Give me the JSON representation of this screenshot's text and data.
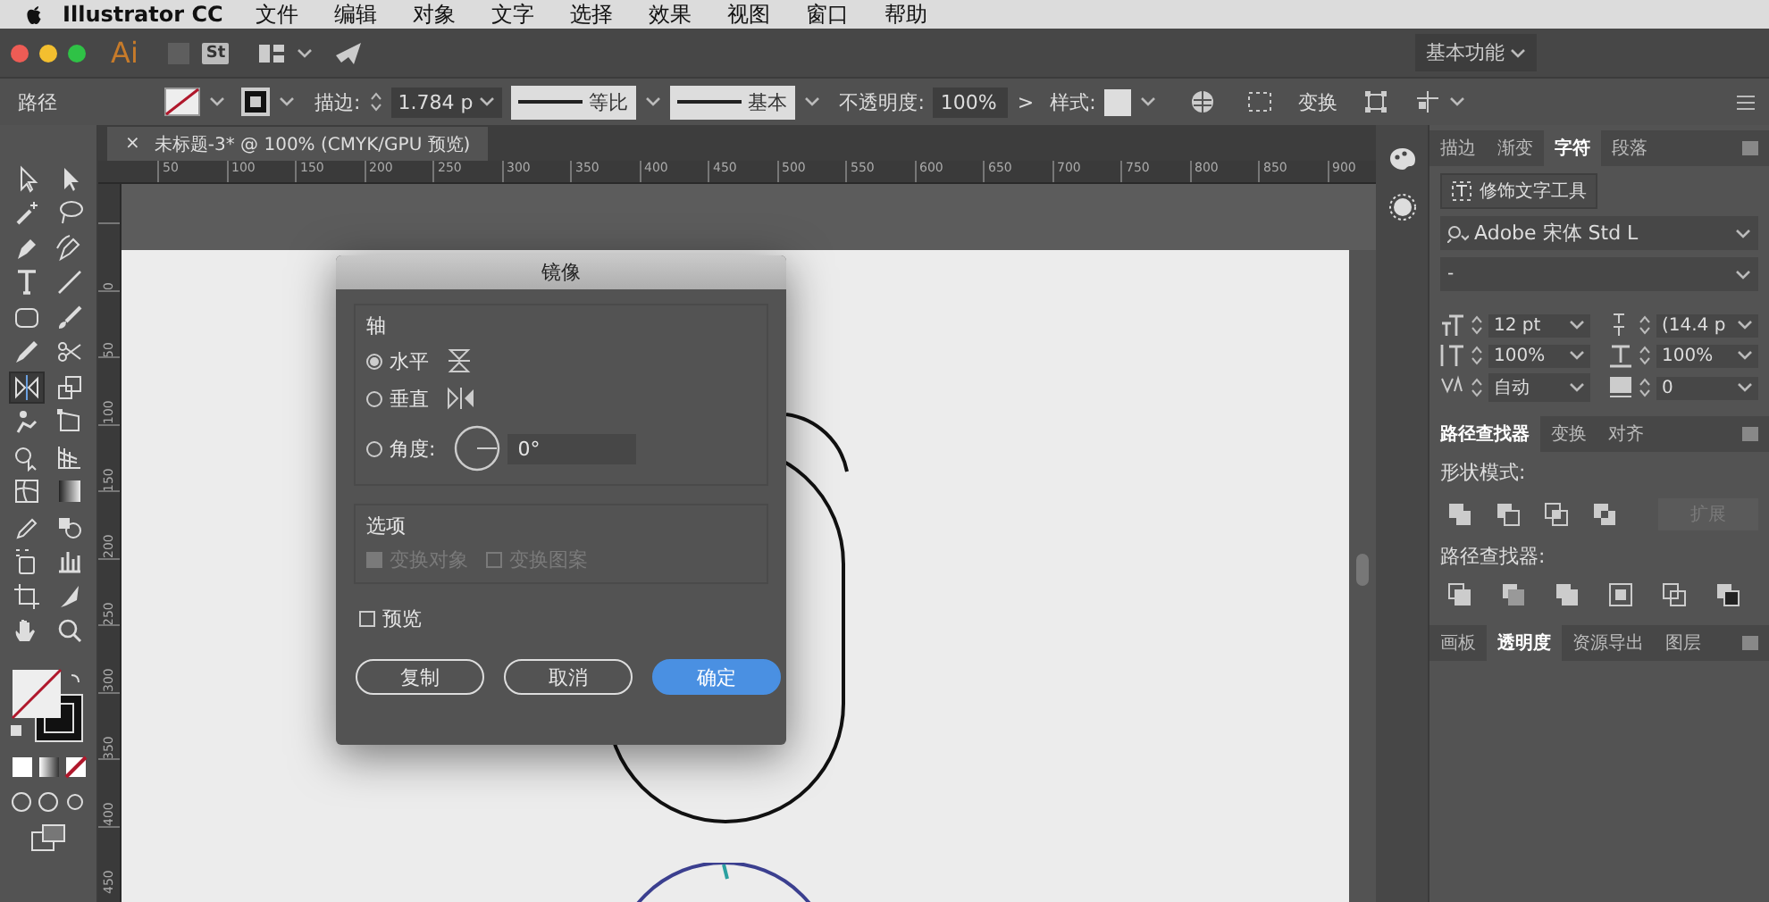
{
  "menubar": {
    "app": "Illustrator CC",
    "menus": [
      "文件",
      "编辑",
      "对象",
      "文字",
      "选择",
      "效果",
      "视图",
      "窗口",
      "帮助"
    ]
  },
  "appbar": {
    "logo": "Ai",
    "stock": "St",
    "workspace": "基本功能"
  },
  "control": {
    "selection": "路径",
    "stroke_label": "描边:",
    "stroke_weight": "1.784 p",
    "profile": "等比",
    "brush": "基本",
    "opacity_label": "不透明度:",
    "opacity": "100%",
    "more": ">",
    "style_label": "样式:",
    "transform": "变换"
  },
  "document": {
    "tab": "未标题-3* @ 100% (CMYK/GPU 预览)",
    "close": "×",
    "ruler_h": [
      "50",
      "100",
      "150",
      "200",
      "250",
      "300",
      "350",
      "400",
      "450",
      "500",
      "550",
      "600",
      "650",
      "700",
      "750",
      "800",
      "850",
      "900"
    ],
    "ruler_v": [
      "0",
      "50",
      "100",
      "150",
      "200",
      "250",
      "300",
      "350",
      "400",
      "450"
    ]
  },
  "tools": [
    {
      "selected": false
    },
    {
      "selected": false
    },
    {
      "selected": false
    },
    {
      "selected": false
    },
    {
      "selected": false
    },
    {
      "selected": false
    },
    {
      "selected": false
    },
    {
      "selected": false
    },
    {
      "selected": false
    },
    {
      "selected": false
    },
    {
      "selected": false
    },
    {
      "selected": false
    },
    {
      "selected": true
    },
    {
      "selected": false
    },
    {
      "selected": false
    },
    {
      "selected": false
    },
    {
      "selected": false
    },
    {
      "selected": false
    },
    {
      "selected": false
    },
    {
      "selected": false
    },
    {
      "selected": false
    },
    {
      "selected": false
    },
    {
      "selected": false
    },
    {
      "selected": false
    },
    {
      "selected": false
    },
    {
      "selected": false
    },
    {
      "selected": false
    },
    {
      "selected": false
    }
  ],
  "dialog": {
    "title": "镜像",
    "axis_label": "轴",
    "axes": [
      {
        "label": "水平",
        "selected": true
      },
      {
        "label": "垂直",
        "selected": false
      },
      {
        "label": "角度:",
        "selected": false
      }
    ],
    "angle": "0°",
    "options_label": "选项",
    "options": [
      {
        "label": "变换对象",
        "checked": true,
        "disabled": true
      },
      {
        "label": "变换图案",
        "checked": false,
        "disabled": true
      }
    ],
    "preview": {
      "label": "预览",
      "checked": false
    },
    "buttons": [
      {
        "label": "复制",
        "primary": false
      },
      {
        "label": "取消",
        "primary": false
      },
      {
        "label": "确定",
        "primary": true
      }
    ]
  },
  "panel": {
    "tabs": [
      {
        "label": "描边",
        "selected": false
      },
      {
        "label": "渐变",
        "selected": false
      },
      {
        "label": "字符",
        "selected": true
      },
      {
        "label": "段落",
        "selected": false
      }
    ],
    "touch_tool": "修饰文字工具",
    "font": "Adobe 宋体 Std L",
    "style": "-",
    "fields": [
      "12 pt",
      "(14.4 p",
      "100%",
      "100%",
      "自动",
      "0"
    ],
    "path_tabs": [
      {
        "label": "路径查找器",
        "selected": true
      },
      {
        "label": "变换",
        "selected": false
      },
      {
        "label": "对齐",
        "selected": false
      }
    ],
    "shape_modes_label": "形状模式:",
    "expand": {
      "label": "扩展",
      "disabled": true
    },
    "pathfinders_label": "路径查找器:",
    "bottom_tabs": [
      {
        "label": "画板",
        "selected": false
      },
      {
        "label": "透明度",
        "selected": true
      },
      {
        "label": "资源导出",
        "selected": false
      },
      {
        "label": "图层",
        "selected": false
      }
    ]
  }
}
